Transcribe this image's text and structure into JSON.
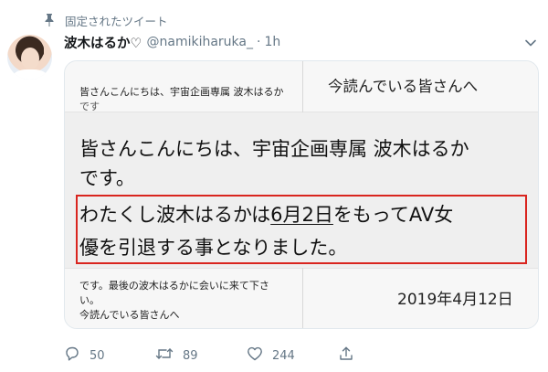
{
  "pinned": {
    "label": "固定されたツイート",
    "icon": "pin-icon"
  },
  "user": {
    "display_name": "波木はるか♡",
    "handle": "@namikiharuka_",
    "separator": "·",
    "time": "1h",
    "avatar": "avatar"
  },
  "media": {
    "top_left_line1": "皆さんこんにちは、宇宙企画専属 波木はるか",
    "top_left_line2": "です",
    "top_right": "今読んでいる皆さんへ",
    "main_line1": "皆さんこんにちは、宇宙企画専属 波木はるか",
    "main_line2": "です。",
    "main_line3_a": "わたくし波木はるかは",
    "main_line3_b": "6月2日",
    "main_line3_c": "をもってAV女",
    "main_line4": "優を引退する事となりました。",
    "bottom_left_line1": "です。最後の波木はるかに会いに来て下さ",
    "bottom_left_line2": "い。",
    "bottom_left_line3": "今読んでいる皆さんへ",
    "bottom_right": "2019年4月12日",
    "highlight_color": "#d9251f"
  },
  "actions": {
    "reply": {
      "icon": "reply-icon",
      "count": "50"
    },
    "retweet": {
      "icon": "retweet-icon",
      "count": "89"
    },
    "like": {
      "icon": "heart-icon",
      "count": "244"
    },
    "share": {
      "icon": "share-icon"
    }
  },
  "colors": {
    "secondary_text": "#657786",
    "primary_text": "#14171a"
  }
}
